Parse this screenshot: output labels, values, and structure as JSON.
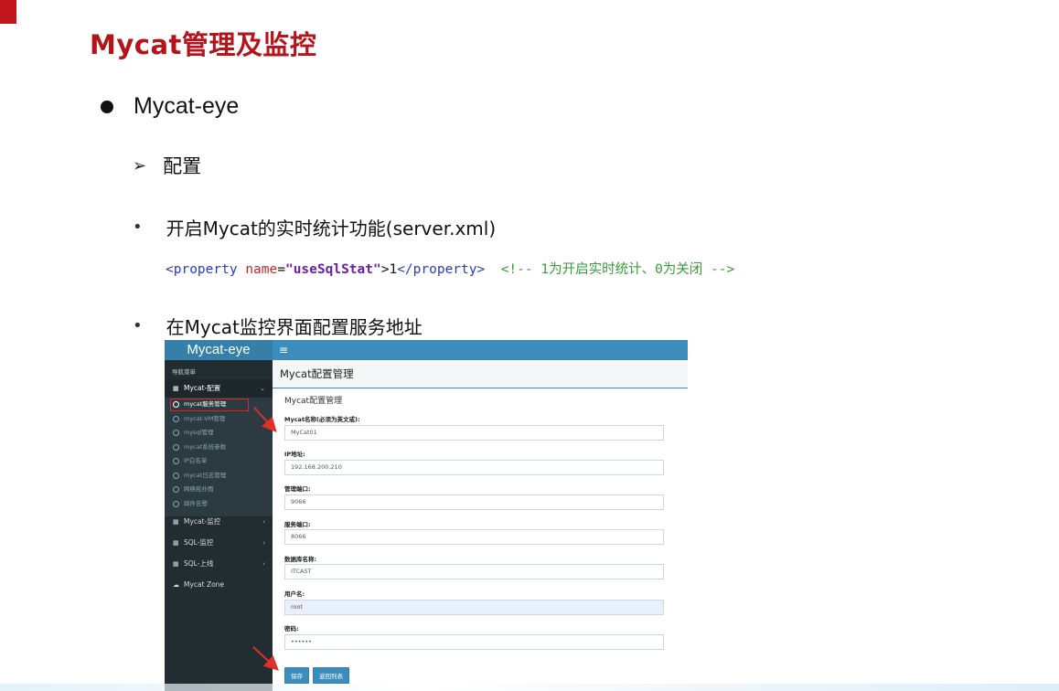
{
  "slide": {
    "title": "Mycat管理及监控",
    "l1": "Mycat-eye",
    "l2": "配置",
    "point1": "开启Mycat的实时统计功能(server.xml)",
    "point2": "在Mycat监控界面配置服务地址",
    "code": {
      "tag_open": "<property",
      "attr": "name",
      "eq": "=",
      "value": "\"useSqlStat\"",
      "gt": ">",
      "text": "1",
      "tag_close": "</property>",
      "comment": "<!-- 1为开启实时统计、0为关闭 -->"
    }
  },
  "screenshot": {
    "brand": "Mycat-eye",
    "menu_toggle": "≡",
    "nav_header": "导航菜单",
    "groups": {
      "config": "Mycat-配置",
      "monitor": "Mycat-监控",
      "sql_monitor": "SQL-监控",
      "sql_online": "SQL-上线",
      "zone": "Mycat Zone"
    },
    "sub_items": [
      "mycat服务管理",
      "mycat-VM管理",
      "mysql管理",
      "mycat系统参数",
      "IP白名单",
      "mycat日志管理",
      "网络拓扑图",
      "邮件告警"
    ],
    "page_title": "Mycat配置管理",
    "box_title": "Mycat配置管理",
    "fields": [
      {
        "label": "Mycat名称(必须为英文或):",
        "value": "MyCat01"
      },
      {
        "label": "IP地址:",
        "value": "192.168.200.210"
      },
      {
        "label": "管理端口:",
        "value": "9066"
      },
      {
        "label": "服务端口:",
        "value": "8066"
      },
      {
        "label": "数据库名称:",
        "value": "ITCAST"
      },
      {
        "label": "用户名:",
        "value": "root"
      },
      {
        "label": "密码:",
        "value": "••••••"
      }
    ],
    "buttons": {
      "save": "保存",
      "back": "返回列表"
    },
    "colors": {
      "topbar": "#3c8dbc",
      "sidebar": "#222d32",
      "highlight": "#d9242a"
    }
  }
}
